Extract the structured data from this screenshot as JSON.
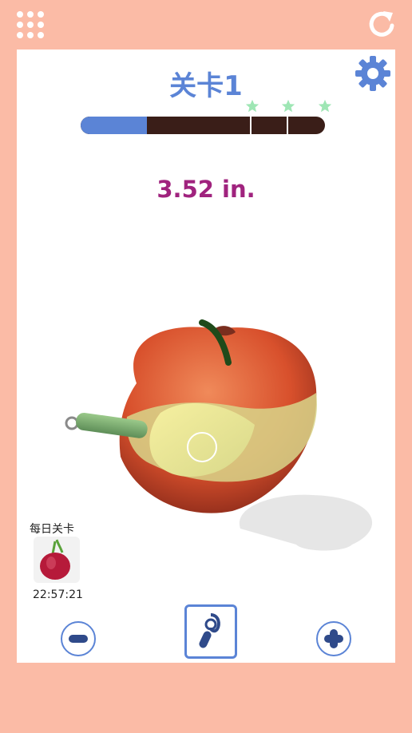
{
  "top_bar": {
    "menu_icon": "grid-menu-icon",
    "reload_icon": "refresh-icon"
  },
  "header": {
    "level_title": "关卡1",
    "settings_icon": "gear-icon"
  },
  "progress": {
    "fill_fraction": 0.27,
    "stars": 3,
    "star_color": "#9ee6b4",
    "fill_color": "#5b84d6",
    "track_color": "#3a1e18"
  },
  "game": {
    "peel_length": "3.52 in.",
    "fruit": "apple"
  },
  "daily": {
    "label": "每日关卡",
    "timer": "22:57:21",
    "icon": "onion-icon"
  },
  "controls": {
    "minus_icon": "minus-icon",
    "tool_icon": "peeler-icon",
    "plus_icon": "plus-icon"
  }
}
